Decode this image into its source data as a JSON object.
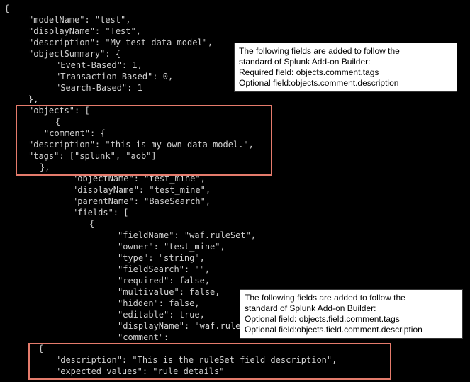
{
  "code": {
    "l0": "{",
    "l1": "\"modelName\": \"test\",",
    "l2": "\"displayName\": \"Test\",",
    "l3": "\"description\": \"My test data model\",",
    "l4": "\"objectSummary\": {",
    "l5": "\"Event-Based\": 1,",
    "l6": "\"Transaction-Based\": 0,",
    "l7": "\"Search-Based\": 1",
    "l8": "},",
    "l9": "\"objects\": [",
    "l10": "{",
    "l11": "\"comment\": {",
    "l12": "\"description\": \"this is my own data model.\",",
    "l13": "\"tags\": [\"splunk\", \"aob\"]",
    "l14": "},",
    "l15": "\"objectName\": \"test_mine\",",
    "l16": "\"displayName\": \"test_mine\",",
    "l17": "\"parentName\": \"BaseSearch\",",
    "l18": "\"fields\": [",
    "l19": "{",
    "l20": "\"fieldName\": \"waf.ruleSet\",",
    "l21": "\"owner\": \"test_mine\",",
    "l22": "\"type\": \"string\",",
    "l23": "\"fieldSearch\": \"\",",
    "l24": "\"required\": false,",
    "l25": "\"multivalue\": false,",
    "l26": "\"hidden\": false,",
    "l27": "\"editable\": true,",
    "l28": "\"displayName\": \"waf.ruleSet\",",
    "l29": "\"comment\":",
    "l30": "{",
    "l31": "\"description\": \"This is the ruleSet field description\",",
    "l32": "\"expected_values\": \"rule_details\""
  },
  "callout1": {
    "line1": "The following fields are added to follow the",
    "line2": "standard of Splunk Add-on Builder:",
    "line3": "Required field: objects.comment.tags",
    "line4": "Optional field:objects.comment.description"
  },
  "callout2": {
    "line1": "The following fields are added to follow the",
    "line2": "standard of Splunk Add-on Builder:",
    "line3": "Optional field: objects.field.comment.tags",
    "line4": "Optional field:objects.field.comment.description"
  }
}
